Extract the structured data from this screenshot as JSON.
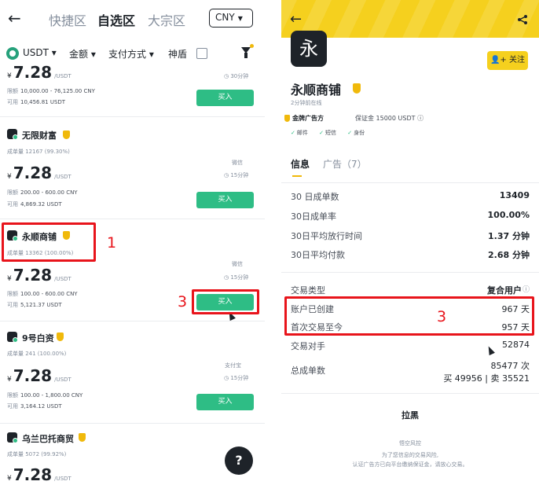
{
  "left": {
    "tabs": [
      "快捷区",
      "自选区",
      "大宗区"
    ],
    "active_tab": "自选区",
    "currency": "CNY",
    "filters": {
      "asset": "USDT",
      "amount": "金额",
      "payment": "支付方式",
      "shield": "神盾"
    },
    "listings": [
      {
        "price_symbol": "¥",
        "price": "7.28",
        "unit": "/USDT",
        "time": "30分钟",
        "limit_label": "限额",
        "limit": "10,000.00 - 76,125.00 CNY",
        "avail_label": "可用",
        "available": "10,456.81 USDT",
        "buy": "买入"
      },
      {
        "name": "无限财富",
        "stats": "成单量 12167 (99.30%)",
        "pay": "微信",
        "price_symbol": "¥",
        "price": "7.28",
        "unit": "/USDT",
        "time": "15分钟",
        "limit_label": "限额",
        "limit": "200.00 - 600.00 CNY",
        "avail_label": "可用",
        "available": "4,869.32 USDT",
        "buy": "买入"
      },
      {
        "name": "永顺商铺",
        "stats": "成单量 13362 (100.00%)",
        "pay": "微信",
        "price_symbol": "¥",
        "price": "7.28",
        "unit": "/USDT",
        "time": "15分钟",
        "limit_label": "限额",
        "limit": "100.00 - 600.00 CNY",
        "avail_label": "可用",
        "available": "5,121.37 USDT",
        "buy": "买入"
      },
      {
        "name": "9号白资",
        "stats": "成单量 241 (100.00%)",
        "pay": "支付宝",
        "price_symbol": "¥",
        "price": "7.28",
        "unit": "/USDT",
        "time": "15分钟",
        "limit_label": "限额",
        "limit": "100.00 - 1,800.00 CNY",
        "avail_label": "可用",
        "available": "3,164.12 USDT",
        "buy": "买入"
      },
      {
        "name": "乌兰巴托商贸",
        "stats": "成单量 5072 (99.92%)",
        "price_symbol": "¥",
        "price": "7.28",
        "unit": "/USDT"
      }
    ],
    "help": "?",
    "annotations": {
      "a1": "1",
      "a3": "3"
    }
  },
  "right": {
    "avatar_char": "永",
    "follow": "关注",
    "merchant_name": "永顺商铺",
    "online": "2分钟前在线",
    "gold": "金牌广告方",
    "deposit": "保证金 15000 USDT",
    "verifications": [
      "邮件",
      "短信",
      "身份"
    ],
    "tabs": {
      "info": "信息",
      "ads": "广告（7）"
    },
    "stats": [
      {
        "label": "30 日成单数",
        "value": "13409"
      },
      {
        "label": "30日成单率",
        "value": "100.00%"
      },
      {
        "label": "30日平均放行时间",
        "value": "1.37 分钟"
      },
      {
        "label": "30日平均付款",
        "value": "2.68 分钟"
      }
    ],
    "details": [
      {
        "label": "交易类型",
        "value": "复合用户"
      },
      {
        "label": "账户已创建",
        "value": "967 天"
      },
      {
        "label": "首次交易至今",
        "value": "957 天"
      },
      {
        "label": "交易对手",
        "value": "52874"
      },
      {
        "label": "总成单数",
        "value": "85477 次"
      }
    ],
    "buy_sell": "买 49956 | 卖 35521",
    "block": "拉黑",
    "footer_title": "悟空风控",
    "footer_1": "为了您信息的交易风险,",
    "footer_2": "认证广告方已向平台缴纳保证金，请放心交易。",
    "annotation": "3"
  }
}
